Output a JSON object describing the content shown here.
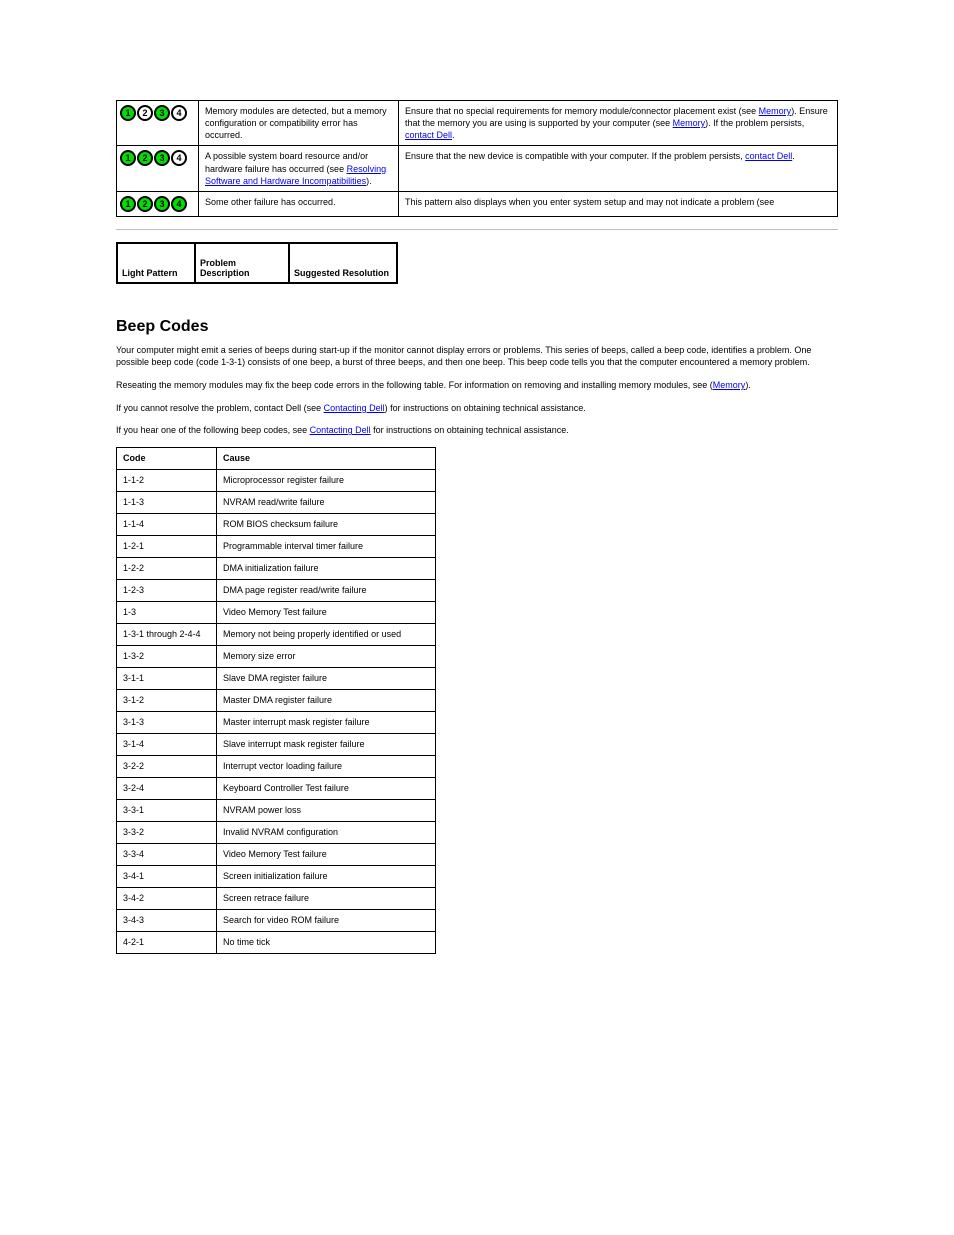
{
  "diag_rows": [
    {
      "led": [
        true,
        false,
        true,
        false
      ],
      "desc": "Memory modules are detected, but a memory configuration or compatibility error has occurred.",
      "fix": "Ensure that no special requirements for memory module/connector placement exist (see <a>Memory</a>). Ensure that the memory you are using is supported by your computer (see <a>Memory</a>). If the problem persists, <a>contact Dell</a>."
    },
    {
      "led": [
        true,
        true,
        true,
        false
      ],
      "desc": "A possible system board resource and/or hardware failure has occurred (see <a>Resolving Software and Hardware Incompatibilities</a>).",
      "fix": "Ensure that the new device is compatible with your computer. If the problem persists, <a>contact Dell</a>."
    },
    {
      "led": [
        true,
        true,
        true,
        true
      ],
      "desc": "Some other failure has occurred.",
      "fix": "This pattern also displays when you enter system setup and may not indicate a problem (see"
    }
  ],
  "hdr": {
    "c1": "Light Pattern",
    "c2": "Problem Description",
    "c3": "Suggested Resolution"
  },
  "beep_section": {
    "title": "Beep Codes",
    "p1": "Your computer might emit a series of beeps during start-up if the monitor cannot display errors or problems. This series of beeps, called a beep code, identifies a problem. One possible beep code (code 1-3-1) consists of one beep, a burst of three beeps, and then one beep. This beep code tells you that the computer encountered a memory problem.",
    "p2": "Reseating the memory modules may fix the beep code errors in the following table.  For information on removing and installing memory modules, see (<a>Memory</a>).",
    "p3_a": "If you cannot resolve the problem, contact Dell (see ",
    "p3_link": "Contacting Dell",
    "p3_b": ") for instructions on obtaining technical assistance.",
    "p4_a": "If you hear one of the following beep codes, see ",
    "p4_link": "Contacting Dell",
    "p4_b": " for instructions on obtaining technical assistance.",
    "table": {
      "head": [
        "Code",
        "Cause"
      ],
      "rows": [
        [
          "1-1-2",
          "Microprocessor register failure"
        ],
        [
          "1-1-3",
          "NVRAM read/write failure"
        ],
        [
          "1-1-4",
          "ROM BIOS checksum failure"
        ],
        [
          "1-2-1",
          "Programmable interval timer failure"
        ],
        [
          "1-2-2",
          "DMA initialization failure"
        ],
        [
          "1-2-3",
          "DMA page register read/write failure"
        ],
        [
          "1-3",
          "Video Memory Test failure"
        ],
        [
          "1-3-1 through 2-4-4",
          "Memory not being properly identified or used"
        ],
        [
          "1-3-2",
          "Memory size error"
        ],
        [
          "3-1-1",
          "Slave DMA register failure"
        ],
        [
          "3-1-2",
          "Master DMA register failure"
        ],
        [
          "3-1-3",
          "Master interrupt mask register failure"
        ],
        [
          "3-1-4",
          "Slave interrupt mask register failure"
        ],
        [
          "3-2-2",
          "Interrupt vector loading failure"
        ],
        [
          "3-2-4",
          "Keyboard Controller Test failure"
        ],
        [
          "3-3-1",
          "NVRAM power loss"
        ],
        [
          "3-3-2",
          "Invalid NVRAM configuration"
        ],
        [
          "3-3-4",
          "Video Memory Test failure"
        ],
        [
          "3-4-1",
          "Screen initialization failure"
        ],
        [
          "3-4-2",
          "Screen retrace failure"
        ],
        [
          "3-4-3",
          "Search for video ROM failure"
        ],
        [
          "4-2-1",
          "No time tick"
        ]
      ]
    }
  }
}
